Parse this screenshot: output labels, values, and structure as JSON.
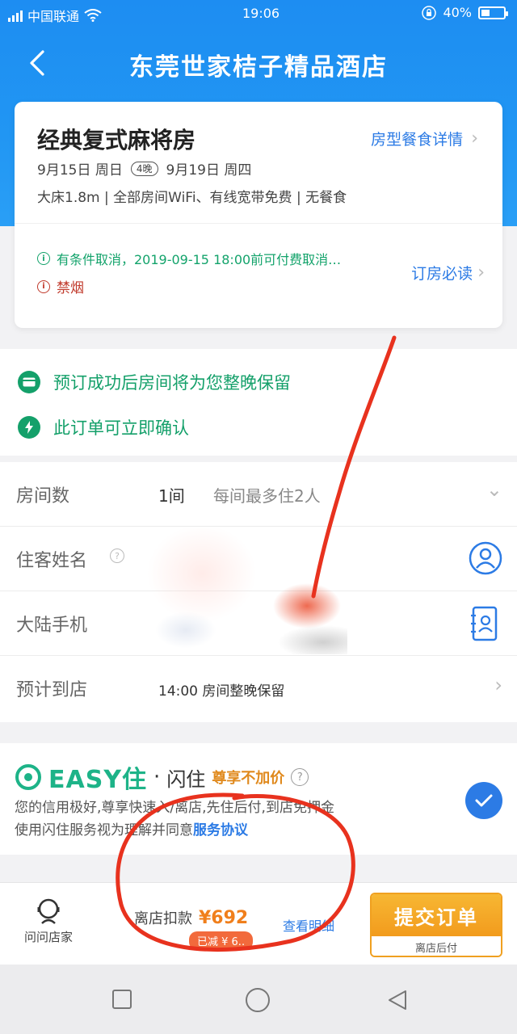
{
  "status_bar": {
    "carrier": "中国联通",
    "time": "19:06",
    "battery": "40%",
    "battery_level": 0.4
  },
  "nav": {
    "title": "东莞世家桔子精品酒店"
  },
  "room": {
    "name": "经典复式麻将房",
    "detail_link": "房型餐食详情",
    "check_in": "9月15日 周日",
    "nights": "4晚",
    "check_out": "9月19日 周四",
    "amenities": "大床1.8m  |  全部房间WiFi、有线宽带免费  |  无餐食",
    "cancel_policy": "有条件取消，2019-09-15 18:00前可付费取消…",
    "smoking": "禁烟",
    "must_read": "订房必读"
  },
  "guarantees": [
    {
      "text": "预订成功后房间将为您整晚保留",
      "icon": "card-icon"
    },
    {
      "text": "此订单可立即确认",
      "icon": "lightning-icon"
    }
  ],
  "form": {
    "rooms": {
      "label": "房间数",
      "value": "1间",
      "note": "每间最多住2人"
    },
    "guest": {
      "label": "住客姓名"
    },
    "phone": {
      "label": "大陆手机"
    },
    "arrival": {
      "label": "预计到店",
      "value": "14:00 房间整晚保留"
    }
  },
  "easy": {
    "logo": "EASY住",
    "dot": "·",
    "name": "闪住",
    "tag": "尊享不加价",
    "desc_line1": "您的信用极好,尊享快速入/离店,先住后付,到店免押金",
    "desc_line2_prefix": "使用闪住服务视为理解并同意",
    "desc_line2_link": "服务协议",
    "checked": true
  },
  "bottom": {
    "ask_label": "问问店家",
    "deduct_label": "离店扣款",
    "deduct_price": "¥692",
    "discount": "已减 ¥ 6..",
    "price_detail": "查看明细",
    "submit_label": "提交订单",
    "submit_sub": "离店后付"
  }
}
